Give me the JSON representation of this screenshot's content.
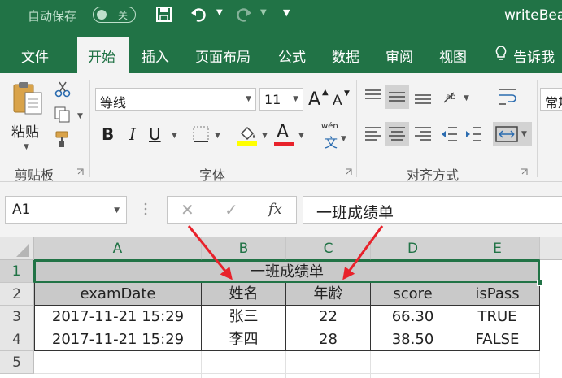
{
  "colors": {
    "excel_green": "#217346",
    "ribbon_bg": "#f3f3f3",
    "header_fill": "#c9c9c9",
    "arrow": "#e8222b",
    "font_color_red": "#e8222b",
    "highlight_yellow": "#ffff00"
  },
  "titlebar": {
    "autosave_label": "自动保存",
    "autosave_state": "关",
    "window_title": "writeBea",
    "icons": [
      "save-icon",
      "undo-icon",
      "redo-icon",
      "customize-qat-icon"
    ]
  },
  "tabs": {
    "file": "文件",
    "home": "开始",
    "insert": "插入",
    "page_layout": "页面布局",
    "formulas": "公式",
    "data": "数据",
    "review": "审阅",
    "view": "视图",
    "tell_me": "告诉我"
  },
  "ribbon": {
    "clipboard": {
      "paste": "粘贴",
      "label": "剪贴板"
    },
    "font": {
      "name": "等线",
      "size": "11",
      "bold": "B",
      "italic": "I",
      "underline": "U",
      "grow": "A",
      "shrink": "A",
      "font_color": "A",
      "wen": "wén",
      "wen_char": "文",
      "label": "字体"
    },
    "alignment": {
      "label": "对齐方式"
    },
    "number": {
      "format": "常规"
    }
  },
  "formula_bar": {
    "name_box": "A1",
    "cancel": "✕",
    "enter": "✓",
    "fx": "fx",
    "content": "一班成绩单"
  },
  "sheet": {
    "columns": [
      "A",
      "B",
      "C",
      "D",
      "E"
    ],
    "rows": [
      "1",
      "2",
      "3",
      "4",
      "5"
    ],
    "title": "一班成绩单",
    "headers": [
      "examDate",
      "姓名",
      "年龄",
      "score",
      "isPass"
    ],
    "data": [
      [
        "2017-11-21 15:29",
        "张三",
        "22",
        "66.30",
        "TRUE"
      ],
      [
        "2017-11-21 15:29",
        "李四",
        "28",
        "38.50",
        "FALSE"
      ]
    ]
  }
}
